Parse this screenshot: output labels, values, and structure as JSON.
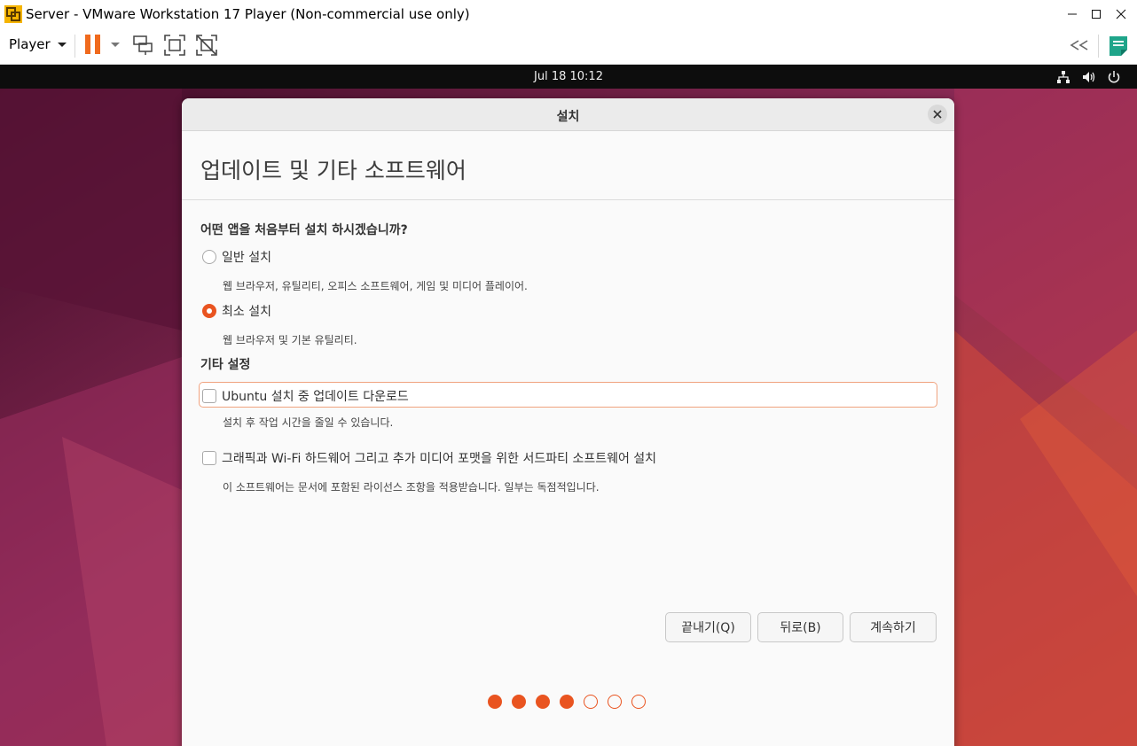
{
  "window": {
    "title": "Server - VMware Workstation 17 Player (Non-commercial use only)",
    "controls": [
      "minimize",
      "maximize",
      "close"
    ]
  },
  "toolbar": {
    "player_label": "Player",
    "icons": [
      "pause-icon",
      "send-ctrl-alt-del-icon",
      "full-screen-icon",
      "unity-icon",
      "collapse-icon",
      "notes-icon"
    ],
    "accent_color": "#f06a1d"
  },
  "guest_topbar": {
    "datetime": "Jul 18  10:12",
    "icons": [
      "network-icon",
      "volume-icon",
      "power-icon"
    ]
  },
  "dialog": {
    "title": "설치",
    "heading": "업데이트 및 기타 소프트웨어",
    "question": "어떤 앱을 처음부터 설치 하시겠습니까?",
    "install_options": [
      {
        "label": "일반 설치",
        "description": "웹 브라우저, 유틸리티, 오피스  소프트웨어, 게임 및 미디어 플레이어.",
        "selected": false
      },
      {
        "label": "최소 설치",
        "description": "웹 브라우저 및 기본 유틸리티.",
        "selected": true
      }
    ],
    "other_settings_title": "기타 설정",
    "other_options": [
      {
        "label": "Ubuntu 설치 중 업데이트 다운로드",
        "description": "설치 후 작업 시간을 줄일 수 있습니다.",
        "checked": false
      },
      {
        "label": "그래픽과 Wi-Fi 하드웨어 그리고 추가 미디어 포맷을 위한 서드파티 소프트웨어 설치",
        "description": "이 소프트웨어는 문서에 포함된 라이선스 조항을 적용받습니다. 일부는 독점적입니다.",
        "checked": false
      }
    ],
    "buttons": {
      "quit": "끝내기(Q)",
      "back": "뒤로(B)",
      "continue": "계속하기"
    },
    "progress": {
      "total_steps": 7,
      "completed_steps": 4
    },
    "accent_color": "#e95420"
  }
}
